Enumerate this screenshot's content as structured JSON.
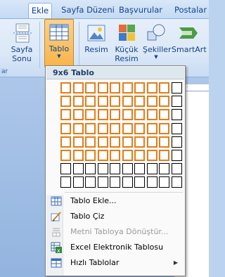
{
  "tabs": [
    {
      "label": "Ekle",
      "active": true
    },
    {
      "label": "Sayfa Düzeni",
      "active": false
    },
    {
      "label": "Başvurular",
      "active": false
    },
    {
      "label": "Postalar",
      "active": false
    }
  ],
  "ribbon": {
    "page_break": {
      "line1": "Sayfa",
      "line2": "Sonu"
    },
    "table": {
      "label": "Tablo"
    },
    "picture": {
      "label": "Resim"
    },
    "clipart": {
      "line1": "Küçük",
      "line2": "Resim"
    },
    "shapes": {
      "label": "Şekiller"
    },
    "smartart": {
      "label": "SmartArt"
    },
    "group_label": "ar"
  },
  "ruler_text": "· 1 ·",
  "menu": {
    "title": "9x6 Tablo",
    "grid": {
      "cols": 10,
      "rows": 8,
      "selected_cols": 9,
      "selected_rows": 6
    },
    "items": [
      {
        "label": "Tablo Ekle...",
        "icon": "insert-table-icon",
        "disabled": false
      },
      {
        "label": "Tablo Çiz",
        "icon": "draw-table-icon",
        "disabled": false
      },
      {
        "label": "Metni Tabloya Dönüştür...",
        "icon": "convert-text-icon",
        "disabled": true
      },
      {
        "label": "Excel Elektronik Tablosu",
        "icon": "excel-sheet-icon",
        "disabled": false
      },
      {
        "label": "Hızlı Tablolar",
        "icon": "quick-tables-icon",
        "disabled": false,
        "submenu": true
      }
    ]
  },
  "colors": {
    "selection": "#e37e1a",
    "pressed": "#f7b44a",
    "accent": "#15428b"
  }
}
